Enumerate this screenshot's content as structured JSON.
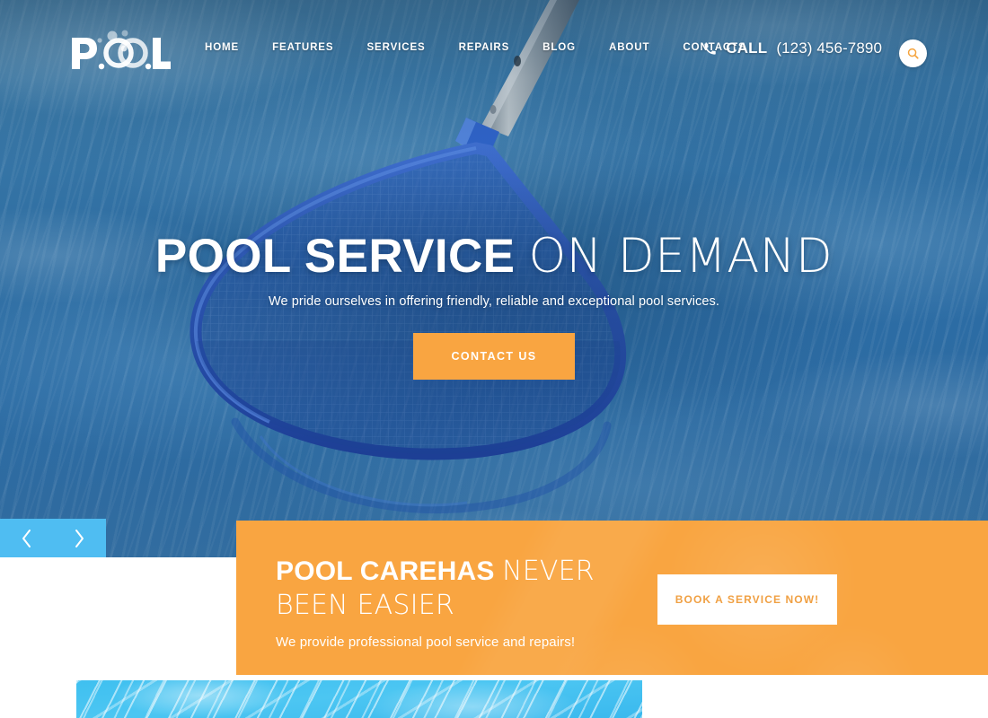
{
  "brand": {
    "logo_text": "P.OOL",
    "logo_name": "pool-logo"
  },
  "colors": {
    "accent_orange": "#F9A541",
    "slider_blue": "#4FBDF2",
    "water_blue": "#3FC0F0",
    "hero_blue": "#2F6EA2",
    "white": "#FFFFFF"
  },
  "header": {
    "nav": [
      {
        "label": "HOME"
      },
      {
        "label": "FEATURES"
      },
      {
        "label": "SERVICES"
      },
      {
        "label": "REPAIRS"
      },
      {
        "label": "BLOG"
      },
      {
        "label": "ABOUT"
      },
      {
        "label": "CONTACTS"
      }
    ],
    "call": {
      "icon": "phone-icon",
      "label": "CALL",
      "number": "(123) 456-7890"
    },
    "search": {
      "icon": "search-icon"
    }
  },
  "hero": {
    "title_bold": "POOL SERVICE",
    "title_light": "ON DEMAND",
    "subtitle": "We pride ourselves in offering friendly, reliable and exceptional pool services.",
    "cta_label": "CONTACT US",
    "slider": {
      "prev_icon": "chevron-left-icon",
      "prev_label": "‹",
      "next_icon": "chevron-right-icon",
      "next_label": "›"
    },
    "background_image": "pool-skimmer-net-in-water"
  },
  "promo": {
    "title_bold": "POOL CAREHAS",
    "title_light": "NEVER BEEN EASIER",
    "subtitle": "We provide professional pool service and repairs!",
    "cta_label": "BOOK A SERVICE NOW!"
  },
  "bottom": {
    "photo_alt": "pool-water-surface"
  }
}
